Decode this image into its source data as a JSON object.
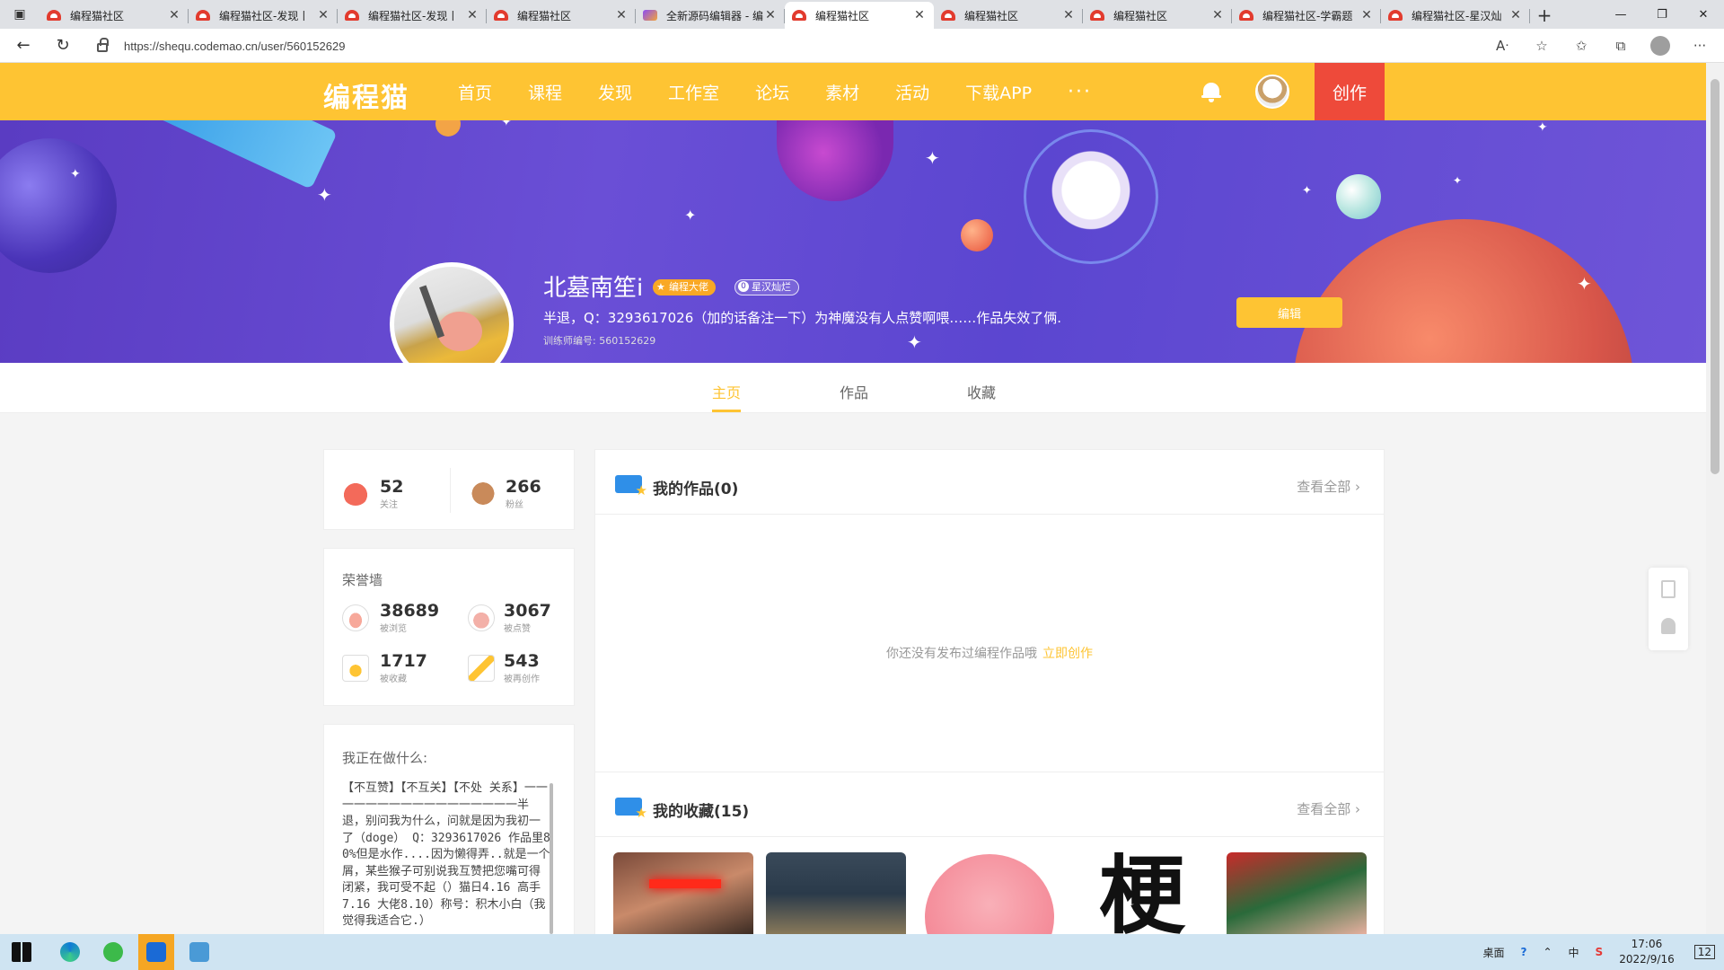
{
  "browser": {
    "tabs": [
      {
        "title": "编程猫社区",
        "active": false,
        "icon": "codemao"
      },
      {
        "title": "编程猫社区-发现丨",
        "active": false,
        "icon": "codemao"
      },
      {
        "title": "编程猫社区-发现丨",
        "active": false,
        "icon": "codemao"
      },
      {
        "title": "编程猫社区",
        "active": false,
        "icon": "codemao"
      },
      {
        "title": "全新源码编辑器 - 编",
        "active": false,
        "icon": "editor"
      },
      {
        "title": "编程猫社区",
        "active": true,
        "icon": "codemao"
      },
      {
        "title": "编程猫社区",
        "active": false,
        "icon": "codemao"
      },
      {
        "title": "编程猫社区",
        "active": false,
        "icon": "codemao"
      },
      {
        "title": "编程猫社区-学霸题",
        "active": false,
        "icon": "codemao"
      },
      {
        "title": "编程猫社区-星汉灿",
        "active": false,
        "icon": "codemao"
      }
    ],
    "url": "https://shequ.codemao.cn/user/560152629"
  },
  "header": {
    "logo": "编程猫",
    "nav": [
      "首页",
      "课程",
      "发现",
      "工作室",
      "论坛",
      "素材",
      "活动",
      "下载APP"
    ],
    "more": "···",
    "create": "创作"
  },
  "profile": {
    "name": "北墓南笙i",
    "badge_level": "编程大佬",
    "badge_honor": "星汉灿烂",
    "bio": "半退，Q：3293617026（加的话备注一下）为神魔没有人点赞啊喂……作品失效了俩.",
    "trainer_id": "训练师编号: 560152629",
    "edit": "编辑"
  },
  "profile_tabs": [
    {
      "label": "主页",
      "active": true
    },
    {
      "label": "作品",
      "active": false
    },
    {
      "label": "收藏",
      "active": false
    }
  ],
  "follow_stats": {
    "following": {
      "num": "52",
      "label": "关注"
    },
    "fans": {
      "num": "266",
      "label": "粉丝"
    }
  },
  "honor": {
    "title": "荣誉墙",
    "views": {
      "num": "38689",
      "label": "被浏览"
    },
    "likes": {
      "num": "3067",
      "label": "被点赞"
    },
    "collects": {
      "num": "1717",
      "label": "被收藏"
    },
    "remixes": {
      "num": "543",
      "label": "被再创作"
    }
  },
  "doing": {
    "title": "我正在做什么:",
    "text": "【不互赞】【不互关】【不处 关系】一一一一一一一一一一一一一一一一一半退，别问我为什么，问就是因为我初一了（doge） Q：3293617026 作品里80%但是水作....因为懒得弄..就是一个屑，某些猴子可别说我互赞把您嘴可得闭紧，我可受不起（）猫日4.16 高手7.16 大佬8.10）称号：积木小白（我觉得我适合它.）"
  },
  "works": {
    "title": "我的作品(0)",
    "more": "查看全部",
    "empty": "你还没有发布过编程作品哦",
    "create_link": "立即创作"
  },
  "collections": {
    "title": "我的收藏(15)",
    "more": "查看全部",
    "thumb_char": "梗"
  },
  "taskbar": {
    "desktop": "桌面",
    "ime": "中",
    "time": "17:06",
    "date": "2022/9/16",
    "notif": "12"
  },
  "colors": {
    "brand_yellow": "#fec433",
    "create_red": "#ee4a3a",
    "banner_purple": "#5a3cc2"
  }
}
